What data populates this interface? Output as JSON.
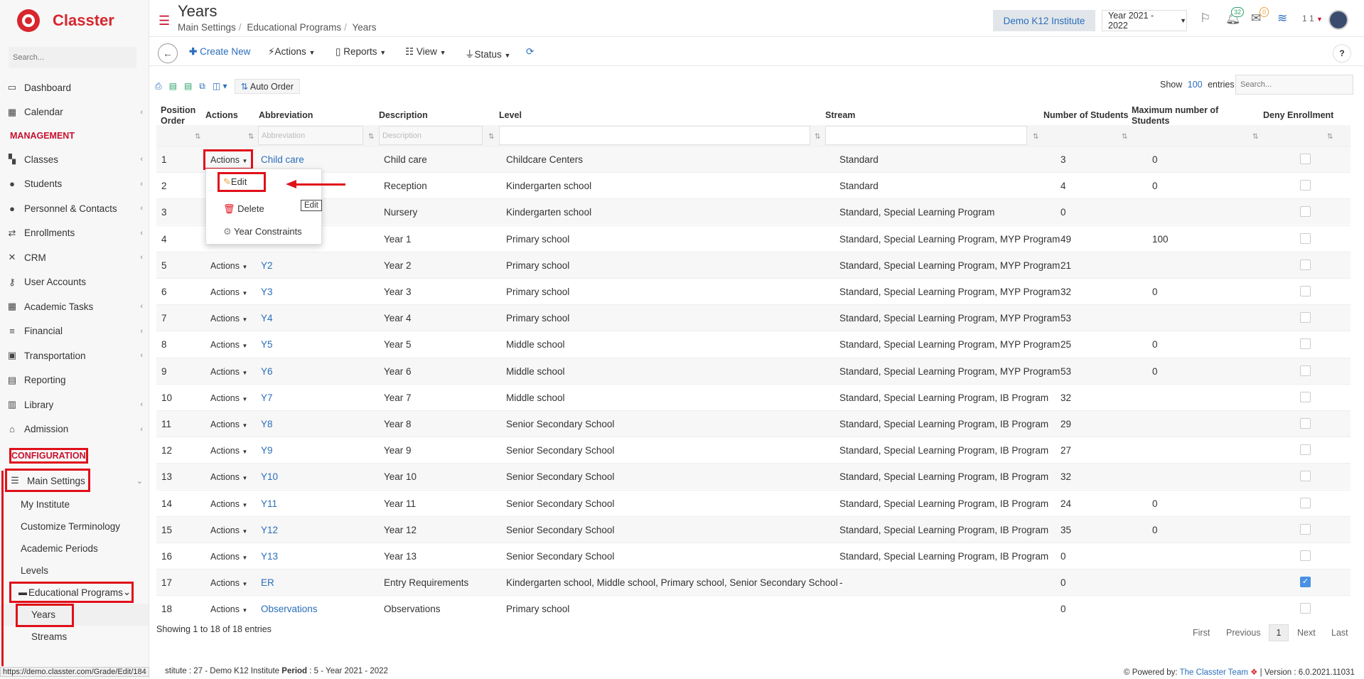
{
  "sidebar": {
    "brand": "Classter",
    "search_placeholder": "Search...",
    "items_top": [
      {
        "label": "Dashboard",
        "icon": "laptop-icon",
        "glyph": "▭",
        "chevron": false
      },
      {
        "label": "Calendar",
        "icon": "calendar-icon",
        "glyph": "▦",
        "chevron": true
      }
    ],
    "management_label": "MANAGEMENT",
    "items_mgmt": [
      {
        "label": "Classes",
        "icon": "classes-icon",
        "glyph": "▚",
        "chevron": true
      },
      {
        "label": "Students",
        "icon": "students-icon",
        "glyph": "●",
        "chevron": true
      },
      {
        "label": "Personnel & Contacts",
        "icon": "personnel-icon",
        "glyph": "●",
        "chevron": true
      },
      {
        "label": "Enrollments",
        "icon": "enrollments-icon",
        "glyph": "⇄",
        "chevron": true
      },
      {
        "label": "CRM",
        "icon": "crm-icon",
        "glyph": "✕",
        "chevron": true
      },
      {
        "label": "User Accounts",
        "icon": "user-accounts-icon",
        "glyph": "⚷",
        "chevron": false
      },
      {
        "label": "Academic Tasks",
        "icon": "academic-tasks-icon",
        "glyph": "▦",
        "chevron": true
      },
      {
        "label": "Financial",
        "icon": "financial-icon",
        "glyph": "≡",
        "chevron": true
      },
      {
        "label": "Transportation",
        "icon": "bus-icon",
        "glyph": "▣",
        "chevron": true
      },
      {
        "label": "Reporting",
        "icon": "printer-icon",
        "glyph": "▤",
        "chevron": false
      },
      {
        "label": "Library",
        "icon": "library-icon",
        "glyph": "▥",
        "chevron": true
      },
      {
        "label": "Admission",
        "icon": "admission-icon",
        "glyph": "⌂",
        "chevron": true
      }
    ],
    "configuration_label": "CONFIGURATION",
    "main_settings": {
      "label": "Main Settings",
      "glyph": "☰"
    },
    "settings_sub": [
      "My Institute",
      "Customize Terminology",
      "Academic Periods",
      "Levels"
    ],
    "educational_programs": {
      "label": "Educational Programs",
      "glyph": "▬"
    },
    "programs_sub": [
      "Years",
      "Streams"
    ]
  },
  "header": {
    "title": "Years",
    "breadcrumb": [
      "Main Settings",
      "Educational Programs",
      "Years"
    ],
    "institute": "Demo K12 Institute",
    "year": "Year 2021 - 2022",
    "notif_count": "32",
    "mail_count": "0",
    "user_num": "1 1"
  },
  "toolbar": {
    "create_new": "Create New",
    "actions": "Actions",
    "reports": "Reports",
    "view": "View",
    "status": "Status",
    "help": "?"
  },
  "table": {
    "auto_order": "Auto Order",
    "show": "Show",
    "entries_count": "100",
    "entries": "entries",
    "search_placeholder": "Search...",
    "columns": {
      "position": "Position Order",
      "actions": "Actions",
      "abbreviation": "Abbreviation",
      "description": "Description",
      "level": "Level",
      "stream": "Stream",
      "num_students": "Number of Students",
      "max_students": "Maximum number of Students",
      "deny": "Deny Enrollment"
    },
    "filter_abbr_placeholder": "Abbreviation",
    "filter_desc_placeholder": "Description",
    "action_label": "Actions",
    "rows": [
      {
        "pos": "1",
        "abbr": "Child care",
        "desc": "Child care",
        "level": "Childcare Centers",
        "stream": "Standard",
        "num": "3",
        "max": "0",
        "deny": false
      },
      {
        "pos": "2",
        "abbr": "",
        "desc": "Reception",
        "level": "Kindergarten school",
        "stream": "Standard",
        "num": "4",
        "max": "0",
        "deny": false
      },
      {
        "pos": "3",
        "abbr": "",
        "desc": "Nursery",
        "level": "Kindergarten school",
        "stream": "Standard, Special Learning Program",
        "num": "0",
        "max": "",
        "deny": false
      },
      {
        "pos": "4",
        "abbr": "",
        "desc": "Year 1",
        "level": "Primary school",
        "stream": "Standard, Special Learning Program, MYP Program",
        "num": "49",
        "max": "100",
        "deny": false
      },
      {
        "pos": "5",
        "abbr": "Y2",
        "desc": "Year 2",
        "level": "Primary school",
        "stream": "Standard, Special Learning Program, MYP Program",
        "num": "21",
        "max": "",
        "deny": false
      },
      {
        "pos": "6",
        "abbr": "Y3",
        "desc": "Year 3",
        "level": "Primary school",
        "stream": "Standard, Special Learning Program, MYP Program",
        "num": "32",
        "max": "0",
        "deny": false
      },
      {
        "pos": "7",
        "abbr": "Y4",
        "desc": "Year 4",
        "level": "Primary school",
        "stream": "Standard, Special Learning Program, MYP Program",
        "num": "53",
        "max": "",
        "deny": false
      },
      {
        "pos": "8",
        "abbr": "Y5",
        "desc": "Year 5",
        "level": "Middle school",
        "stream": "Standard, Special Learning Program, MYP Program",
        "num": "25",
        "max": "0",
        "deny": false
      },
      {
        "pos": "9",
        "abbr": "Y6",
        "desc": "Year 6",
        "level": "Middle school",
        "stream": "Standard, Special Learning Program, MYP Program",
        "num": "53",
        "max": "0",
        "deny": false
      },
      {
        "pos": "10",
        "abbr": "Y7",
        "desc": "Year 7",
        "level": "Middle school",
        "stream": "Standard, Special Learning Program, IB Program",
        "num": "32",
        "max": "",
        "deny": false
      },
      {
        "pos": "11",
        "abbr": "Y8",
        "desc": "Year 8",
        "level": "Senior Secondary School",
        "stream": "Standard, Special Learning Program, IB Program",
        "num": "29",
        "max": "",
        "deny": false
      },
      {
        "pos": "12",
        "abbr": "Y9",
        "desc": "Year 9",
        "level": "Senior Secondary School",
        "stream": "Standard, Special Learning Program, IB Program",
        "num": "27",
        "max": "",
        "deny": false
      },
      {
        "pos": "13",
        "abbr": "Y10",
        "desc": "Year 10",
        "level": "Senior Secondary School",
        "stream": "Standard, Special Learning Program, IB Program",
        "num": "32",
        "max": "",
        "deny": false
      },
      {
        "pos": "14",
        "abbr": "Y11",
        "desc": "Year 11",
        "level": "Senior Secondary School",
        "stream": "Standard, Special Learning Program, IB Program",
        "num": "24",
        "max": "0",
        "deny": false
      },
      {
        "pos": "15",
        "abbr": "Y12",
        "desc": "Year 12",
        "level": "Senior Secondary School",
        "stream": "Standard, Special Learning Program, IB Program",
        "num": "35",
        "max": "0",
        "deny": false
      },
      {
        "pos": "16",
        "abbr": "Y13",
        "desc": "Year 13",
        "level": "Senior Secondary School",
        "stream": "Standard, Special Learning Program, IB Program",
        "num": "0",
        "max": "",
        "deny": false
      },
      {
        "pos": "17",
        "abbr": "ER",
        "desc": "Entry Requirements",
        "level": "Kindergarten school, Middle school, Primary school, Senior Secondary School",
        "stream": "-",
        "num": "0",
        "max": "",
        "deny": true
      },
      {
        "pos": "18",
        "abbr": "Observations",
        "desc": "Observations",
        "level": "Primary school",
        "stream": "",
        "num": "0",
        "max": "",
        "deny": false
      }
    ],
    "showing": "Showing 1 to 18 of 18 entries",
    "pager": {
      "first": "First",
      "previous": "Previous",
      "current": "1",
      "next": "Next",
      "last": "Last"
    }
  },
  "dropdown": {
    "edit": "Edit",
    "delete": "Delete",
    "year_constraints": "Year Constraints",
    "tooltip": "Edit"
  },
  "status": {
    "url": "https://demo.classter.com/Grade/Edit/184",
    "footer_left_text": "stitute : 27 - Demo K12 Institute",
    "period_label": "Period",
    "period_value": ": 5 - Year 2021 - 2022",
    "powered_by": "Powered by:",
    "powered_team": "The Classter Team",
    "version": "| Version : 6.0.2021.11031"
  },
  "colors": {
    "brand_red": "#d7262e",
    "link_blue": "#2a6ebb",
    "annotation_red": "#e0101a"
  }
}
